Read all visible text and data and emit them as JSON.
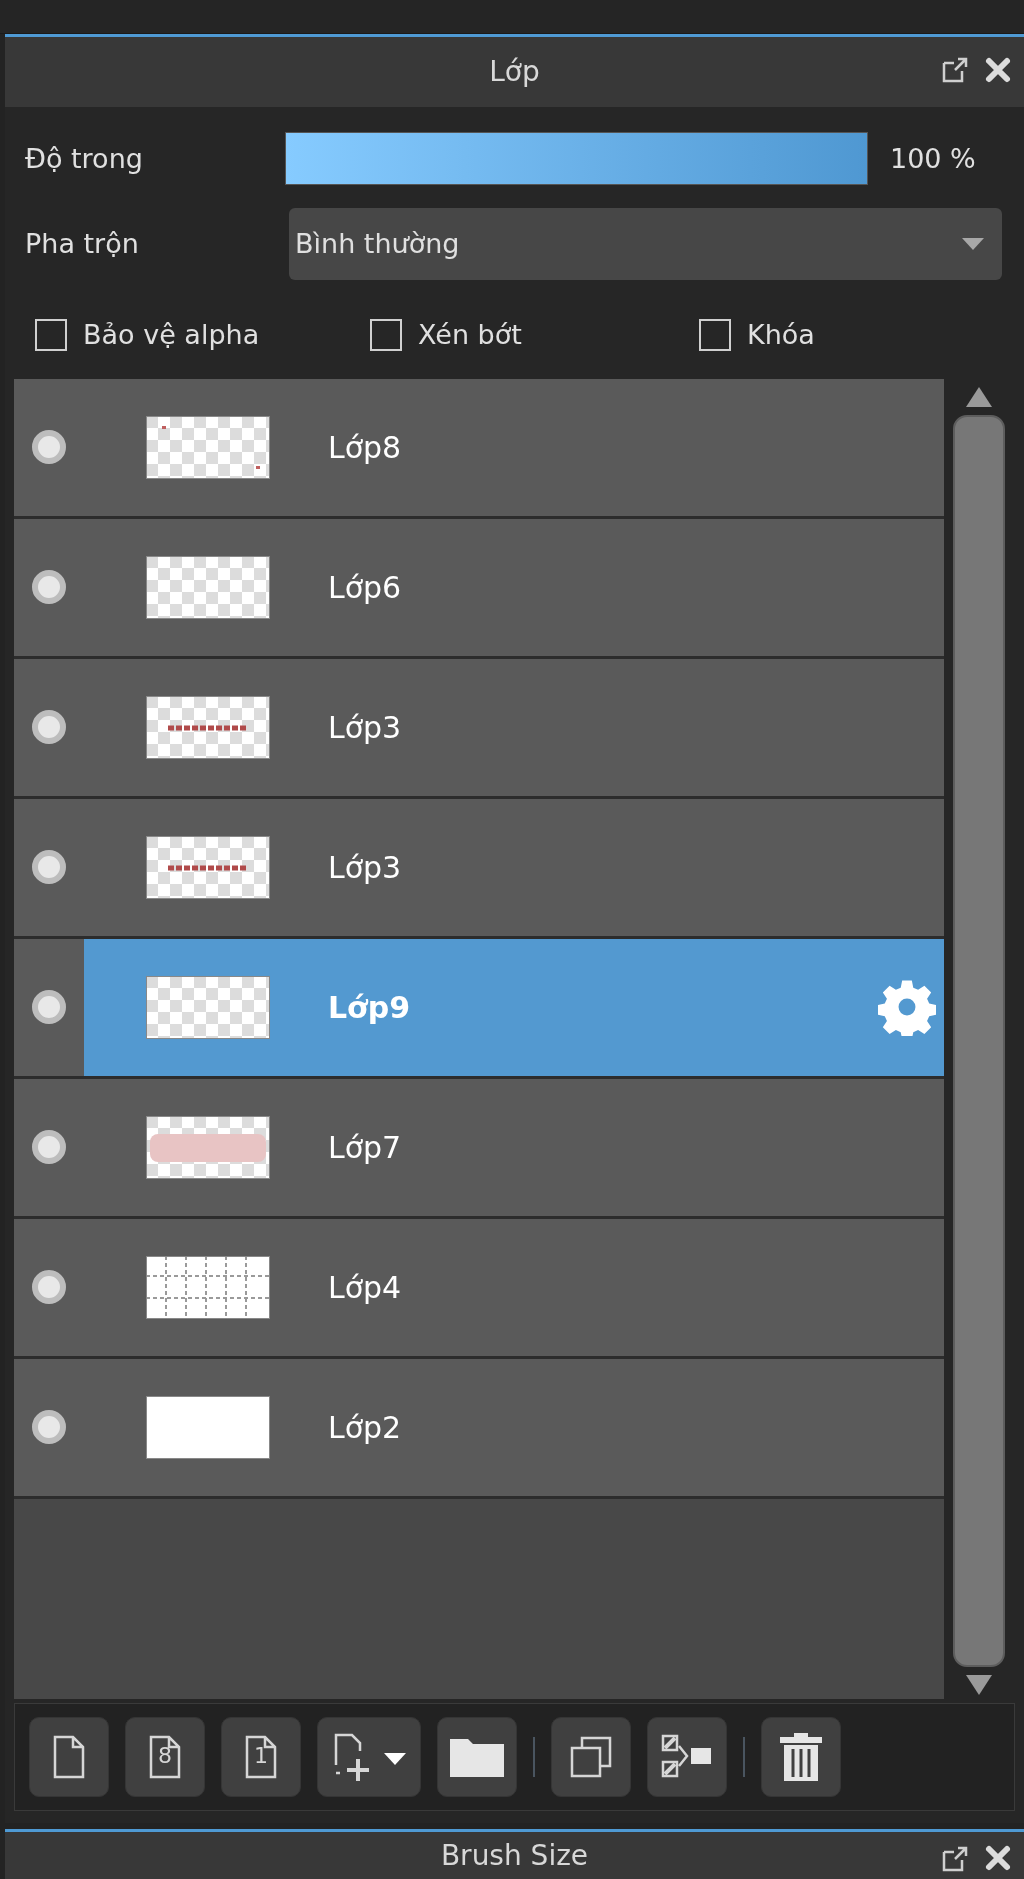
{
  "panel": {
    "title": "Lớp"
  },
  "opacity": {
    "label": "Độ trong",
    "level": 1,
    "reading": "100 %"
  },
  "blend": {
    "label": "Pha trộn",
    "value": "Bình thường"
  },
  "options": [
    {
      "label": "Bảo vệ alpha",
      "checked": false
    },
    {
      "label": "Xén bớt",
      "checked": false
    },
    {
      "label": "Khóa",
      "checked": false
    }
  ],
  "layers": [
    {
      "name": "Lớp8",
      "visible": true,
      "selected": false,
      "kind": "specks"
    },
    {
      "name": "Lớp6",
      "visible": true,
      "selected": false,
      "kind": "empty"
    },
    {
      "name": "Lớp3",
      "visible": true,
      "selected": false,
      "kind": "text"
    },
    {
      "name": "Lớp3",
      "visible": true,
      "selected": false,
      "kind": "text"
    },
    {
      "name": "Lớp9",
      "visible": true,
      "selected": true,
      "kind": "empty"
    },
    {
      "name": "Lớp7",
      "visible": true,
      "selected": false,
      "kind": "pink"
    },
    {
      "name": "Lớp4",
      "visible": true,
      "selected": false,
      "kind": "grid"
    },
    {
      "name": "Lớp2",
      "visible": true,
      "selected": false,
      "kind": "white"
    }
  ],
  "toolbar": [
    {
      "kind": "page"
    },
    {
      "kind": "page-digit",
      "glyph": "8"
    },
    {
      "kind": "page-digit",
      "glyph": "1"
    },
    {
      "kind": "add-menu"
    },
    {
      "kind": "folder"
    },
    {
      "kind": "separator"
    },
    {
      "kind": "copy"
    },
    {
      "kind": "merge"
    },
    {
      "kind": "separator"
    },
    {
      "kind": "trash"
    }
  ],
  "next_panel": {
    "title": "Brush Size"
  }
}
